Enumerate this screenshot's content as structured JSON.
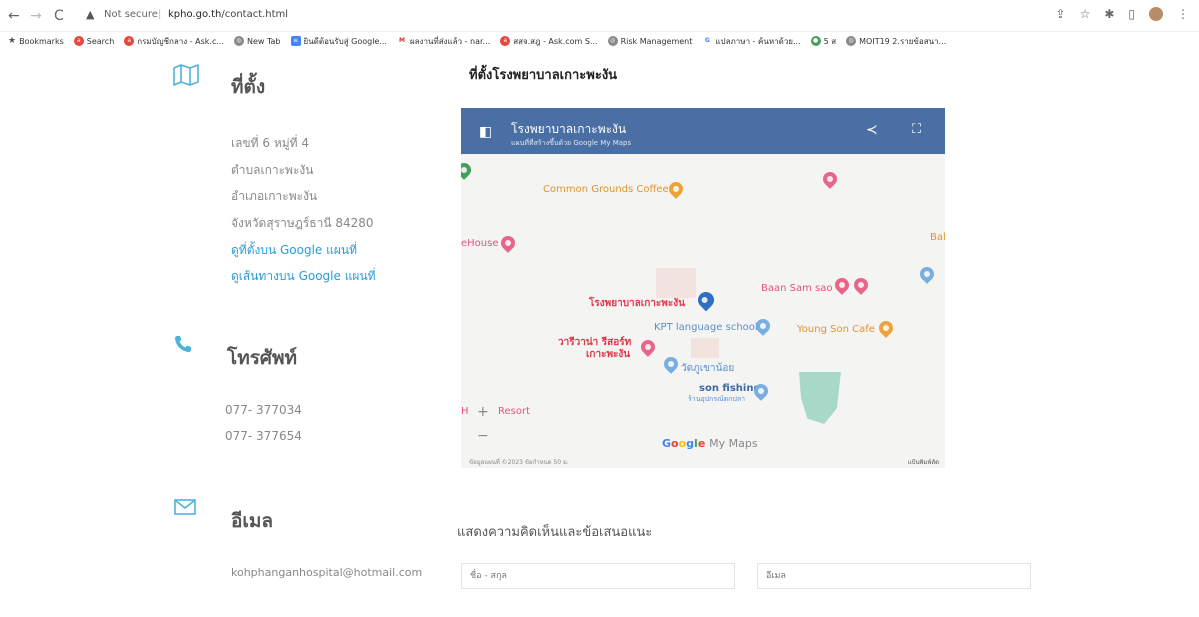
{
  "browser": {
    "nav_back": "←",
    "nav_forward": "→",
    "nav_reload": "C",
    "security_label": "Not secure",
    "url_domain": "kpho.go.th",
    "url_path": "/contact.html",
    "bookmarks": [
      {
        "label": "Bookmarks",
        "icon": "star-icon",
        "color": "#555555"
      },
      {
        "label": "Search",
        "icon": "search-badge-icon",
        "color": "#e8453c"
      },
      {
        "label": "กรมบัญชีกลาง - Ask.c...",
        "icon": "ask-icon",
        "color": "#e8453c"
      },
      {
        "label": "New Tab",
        "icon": "globe-icon",
        "color": "#666666"
      },
      {
        "label": "ยินดีต้อนรับสู่ Google...",
        "icon": "docs-icon",
        "color": "#4285f4"
      },
      {
        "label": "ผลงานที่ส่งแล้ว - nar...",
        "icon": "gmail-icon",
        "color": "#d93025"
      },
      {
        "label": "สสจ.สฎ - Ask.com S...",
        "icon": "ask-icon",
        "color": "#e8453c"
      },
      {
        "label": "Risk Management",
        "icon": "globe-icon",
        "color": "#666666"
      },
      {
        "label": "แปลภาษา - ค้นหาด้วย...",
        "icon": "google-icon",
        "color": "#4285f4"
      },
      {
        "label": "5 ส",
        "icon": "green-dot-icon",
        "color": "#43a05a"
      },
      {
        "label": "MOIT19 2.รายข้อสนา...",
        "icon": "globe-icon",
        "color": "#666666"
      }
    ]
  },
  "location": {
    "title": "ที่ตั้ง",
    "address": [
      "เลขที่ 6 หมู่ที่ 4",
      "ตำบลเกาะพะงัน",
      "อำเภอเกาะพะงัน",
      "จังหวัดสุราษฎร์ธานี 84280"
    ],
    "links": [
      "ดูที่ตั้งบน Google แผนที่",
      "ดูเส้นทางบน Google แผนที่"
    ]
  },
  "phone": {
    "title": "โทรศัพท์",
    "numbers": [
      "077- 377034",
      "077- 377654"
    ]
  },
  "email": {
    "title": "อีเมล",
    "address": "kohphanganhospital@hotmail.com"
  },
  "map": {
    "heading": "ที่ตั้งโรงพยาบาลเกาะพะงัน",
    "header_title": "โรงพยาบาลเกาะพะงัน",
    "header_sub": "แผนที่ที่สร้างขึ้นด้วย Google My Maps",
    "places": {
      "common_grounds": "Common Grounds Coffee",
      "house": "eHouse",
      "bal": "Bal",
      "baan_sam_sao": "Baan Sam sao",
      "hospital": "โรงพยาบาลเกาะพะงัน",
      "kpt": "KPT language school",
      "young_son": "Young Son Cafe",
      "resort_line1": "วารีวาน่า รีสอร์ท",
      "resort_line2": "เกาะพะงัน",
      "temple": "วัดภูเขาน้อย",
      "son_fishing": "son fishing",
      "son_fishing_sub": "ร้านอุปกรณ์ตกปลา",
      "h_resort": "H",
      "resort": "Resort"
    },
    "zoom_in": "+",
    "zoom_out": "−",
    "google_logo": [
      "G",
      "o",
      "o",
      "g",
      "l",
      "e"
    ],
    "my_maps": "My Maps",
    "footer_left": "ข้อมูลแผนที่ ©2023   ข้อกำหนด   50 ม.",
    "footer_right": "แป้นพิมพ์ลัด"
  },
  "feedback": {
    "title": "แสดงความคิดเห็นและข้อเสนอแนะ",
    "name_placeholder": "ชื่อ - สกุล",
    "email_placeholder": "อีเมล"
  },
  "colors": {
    "accent_blue": "#4fb2db",
    "link_blue": "#2a9cd8",
    "map_header": "#4a6fa5"
  }
}
